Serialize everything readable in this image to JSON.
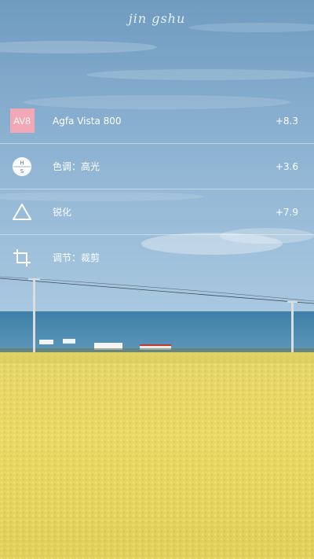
{
  "watermark": "jin gshu",
  "colors": {
    "badge": "#f3a8b8",
    "icon": "#ffffff"
  },
  "adjustments": [
    {
      "icon": "av8-badge",
      "badge_text": "AV8",
      "label": "Agfa Vista 800",
      "value": "+8.3"
    },
    {
      "icon": "hs-circle-icon",
      "label": "色调：高光",
      "value": "+3.6"
    },
    {
      "icon": "triangle-icon",
      "label": "锐化",
      "value": "+7.9"
    },
    {
      "icon": "crop-icon",
      "label": "调节：裁剪",
      "value": ""
    }
  ]
}
